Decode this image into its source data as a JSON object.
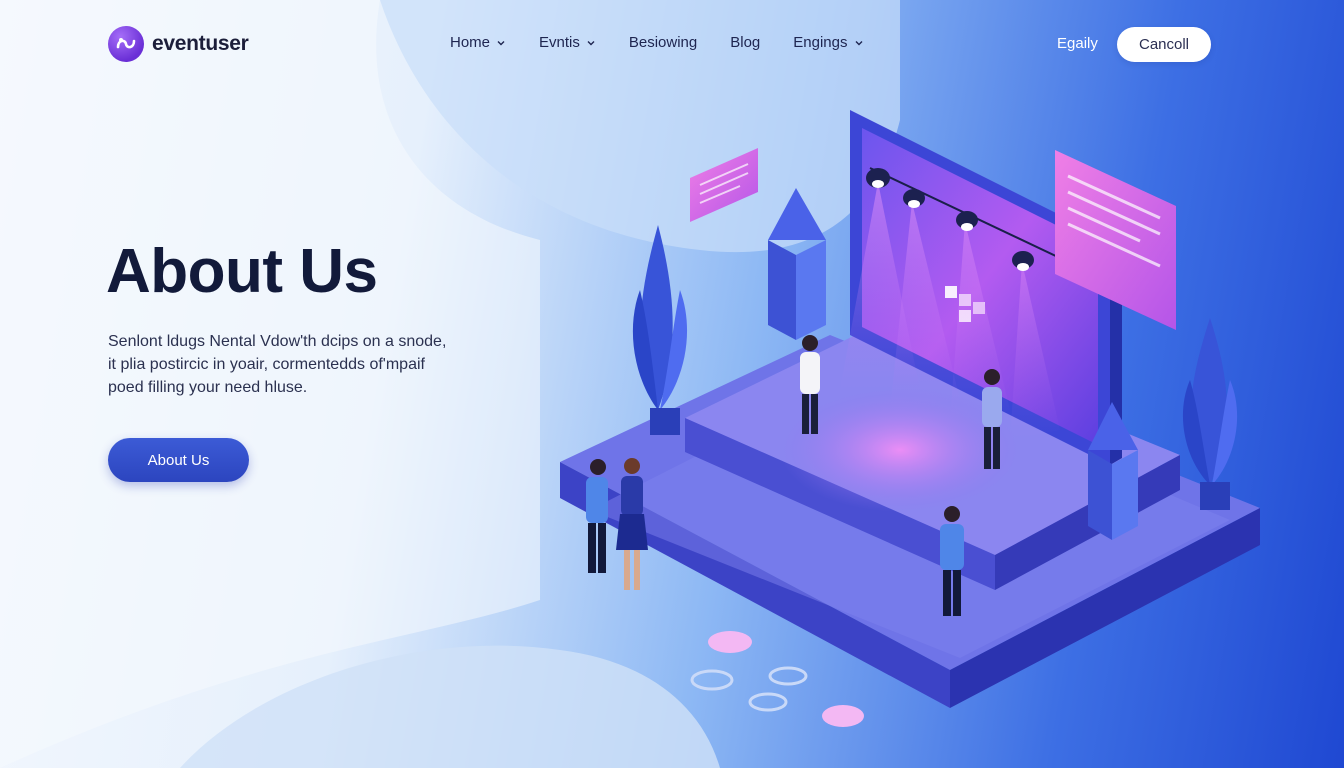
{
  "brand": {
    "name": "eventuser",
    "logo_icon": "brand-logo-icon"
  },
  "nav": {
    "items": [
      {
        "label": "Home",
        "has_dropdown": true
      },
      {
        "label": "Evntis",
        "has_dropdown": true
      },
      {
        "label": "Besiowing",
        "has_dropdown": false
      },
      {
        "label": "Blog",
        "has_dropdown": false
      },
      {
        "label": "Engings",
        "has_dropdown": true
      }
    ],
    "signin_label": "Egaily",
    "cta_label": "Cancoll"
  },
  "hero": {
    "title": "About Us",
    "body_lines": [
      "Senlont ldugs Nental Vdow'th dcips on a snode,",
      "it plia postircic in yoair, cormentedds of'mpaif",
      "poed filling your need hluse."
    ],
    "button_label": "About Us"
  },
  "colors": {
    "primary": "#2f49c4",
    "accent_pink": "#e46cf0",
    "stage_purple": "#5a4de6",
    "text_dark": "#121a3a"
  },
  "illustration": {
    "icons": [
      "stage-icon",
      "spotlight-icon",
      "screen-icon",
      "plant-icon",
      "person-icon"
    ]
  }
}
